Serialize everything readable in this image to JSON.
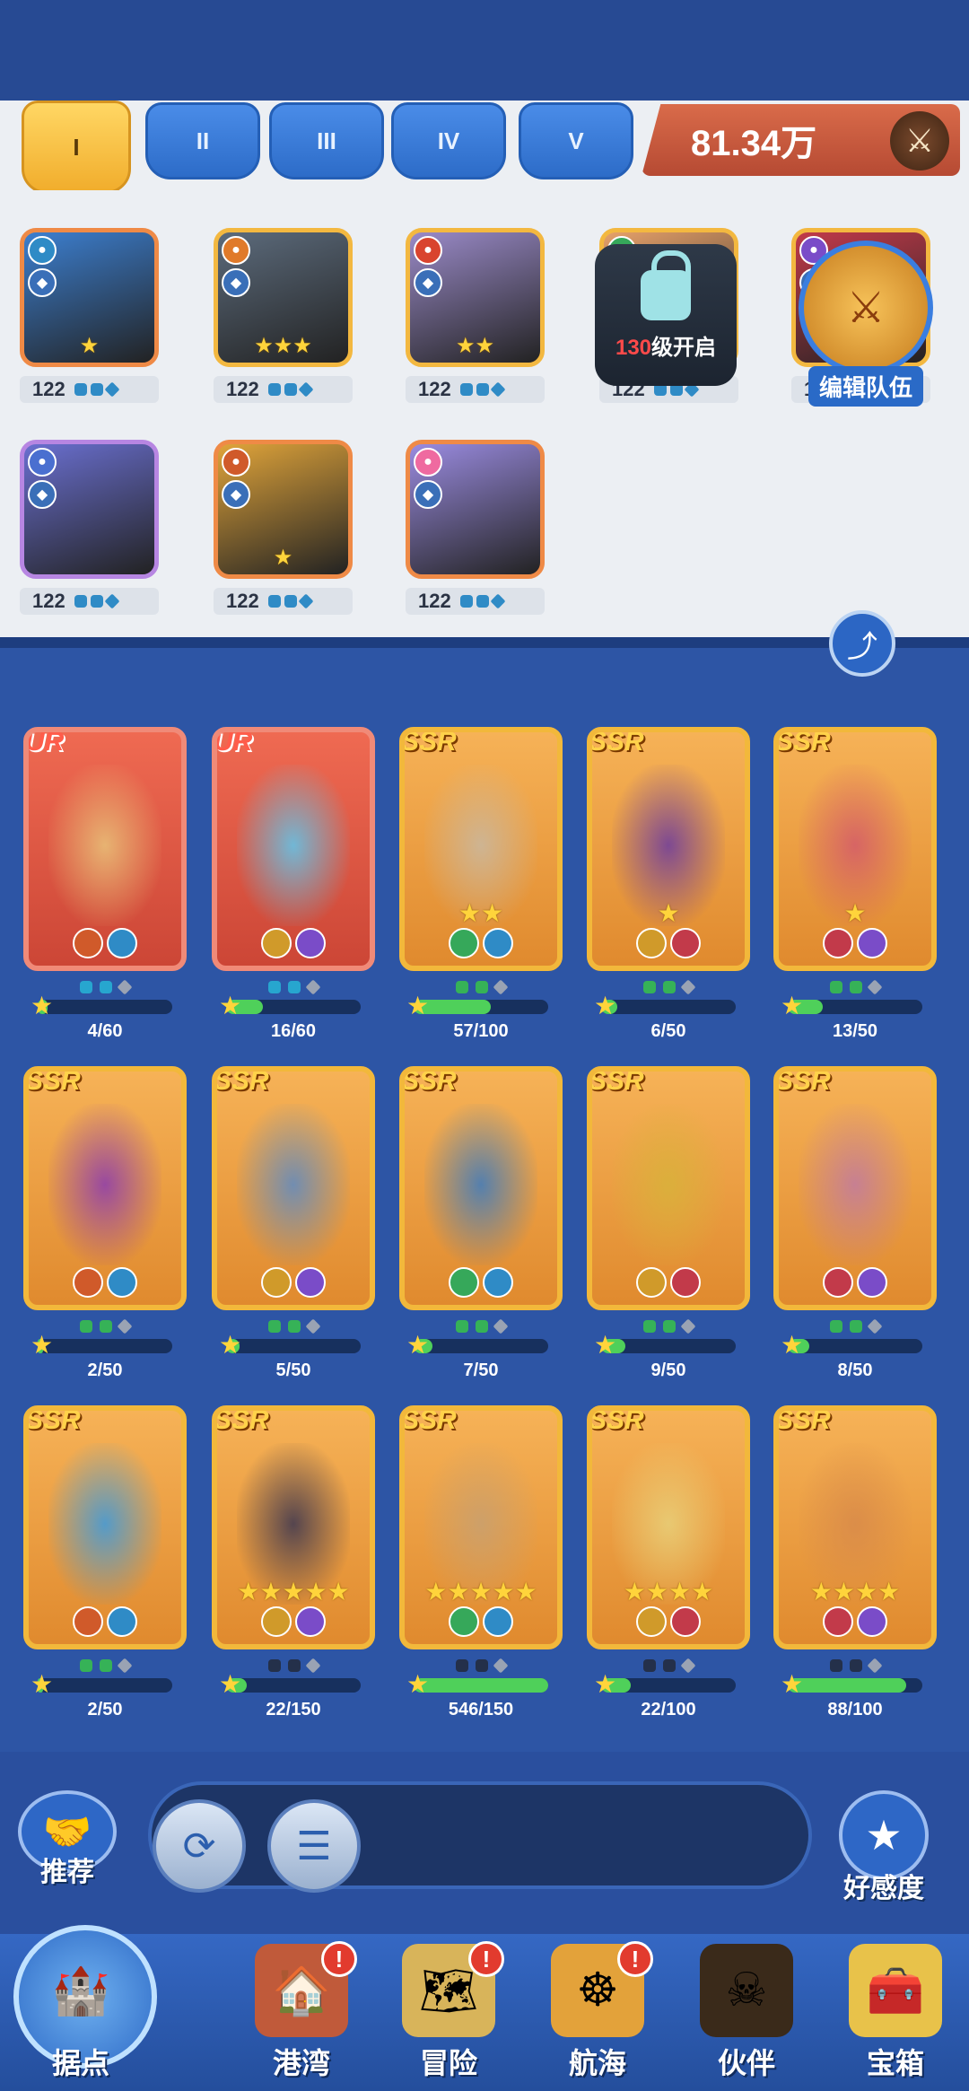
{
  "formation": {
    "tabs": [
      {
        "label": "I",
        "active": true
      },
      {
        "label": "II",
        "active": false
      },
      {
        "label": "III",
        "active": false
      },
      {
        "label": "IV",
        "active": false
      },
      {
        "label": "V",
        "active": false
      }
    ],
    "power": "81.34万"
  },
  "team": [
    {
      "level": "122",
      "stars": "★",
      "border": "orange",
      "color": "#3c7fd0"
    },
    {
      "level": "122",
      "stars": "★★★",
      "border": "gold",
      "color": "#5c6b7c"
    },
    {
      "level": "122",
      "stars": "★★",
      "border": "gold",
      "color": "#9a8ac8"
    },
    {
      "level": "122",
      "stars": "★★",
      "border": "gold",
      "color": "#e6a16a"
    },
    {
      "level": "122",
      "stars": "★★",
      "border": "gold",
      "color": "#c23a4a"
    },
    {
      "level": "122",
      "stars": "",
      "border": "purple",
      "color": "#6a6fd0"
    },
    {
      "level": "122",
      "stars": "★",
      "border": "orange",
      "color": "#e0a43a"
    },
    {
      "level": "122",
      "stars": "",
      "border": "orange",
      "color": "#9a8be0"
    }
  ],
  "locked_slot": {
    "level_num": "130",
    "suffix": "级开启"
  },
  "edit_team": "编辑队伍",
  "roster": [
    {
      "rarity": "UR",
      "count": "4/60",
      "stars": "",
      "progress": 0.07,
      "color": "#e9c37a"
    },
    {
      "rarity": "UR",
      "count": "16/60",
      "stars": "",
      "progress": 0.27,
      "color": "#5ec8ef"
    },
    {
      "rarity": "SSR",
      "count": "57/100",
      "stars": "★★",
      "progress": 0.57,
      "color": "#c9b8a0"
    },
    {
      "rarity": "SSR",
      "count": "6/50",
      "stars": "★",
      "progress": 0.12,
      "color": "#6a3aa0"
    },
    {
      "rarity": "SSR",
      "count": "13/50",
      "stars": "★",
      "progress": 0.26,
      "color": "#d35a6a"
    },
    {
      "rarity": "SSR",
      "count": "2/50",
      "stars": "",
      "progress": 0.04,
      "color": "#8a3ab0"
    },
    {
      "rarity": "SSR",
      "count": "5/50",
      "stars": "",
      "progress": 0.1,
      "color": "#5c8ac4"
    },
    {
      "rarity": "SSR",
      "count": "7/50",
      "stars": "",
      "progress": 0.14,
      "color": "#3a7ac0"
    },
    {
      "rarity": "SSR",
      "count": "9/50",
      "stars": "",
      "progress": 0.18,
      "color": "#d8b23a"
    },
    {
      "rarity": "SSR",
      "count": "8/50",
      "stars": "",
      "progress": 0.16,
      "color": "#c07aa0"
    },
    {
      "rarity": "SSR",
      "count": "2/50",
      "stars": "",
      "progress": 0.04,
      "color": "#3a9ae0"
    },
    {
      "rarity": "SSR",
      "count": "22/150",
      "stars": "★★★★★",
      "progress": 0.15,
      "color": "#3a3550"
    },
    {
      "rarity": "SSR",
      "count": "546/150",
      "stars": "★★★★★",
      "progress": 1.0,
      "color": "#c8a070"
    },
    {
      "rarity": "SSR",
      "count": "22/100",
      "stars": "★★★★",
      "progress": 0.22,
      "color": "#e8d07a"
    },
    {
      "rarity": "SSR",
      "count": "88/100",
      "stars": "★★★★",
      "progress": 0.88,
      "color": "#d88a4a"
    }
  ],
  "actions": {
    "recommend": "推荐",
    "favor": "好感度"
  },
  "nav": [
    {
      "label": "据点",
      "badge": "",
      "icon": "🏰"
    },
    {
      "label": "港湾",
      "badge": "!",
      "icon": "🏠"
    },
    {
      "label": "冒险",
      "badge": "!",
      "icon": "🗺"
    },
    {
      "label": "航海",
      "badge": "!",
      "icon": "☸"
    },
    {
      "label": "伙伴",
      "badge": "",
      "icon": "☠"
    },
    {
      "label": "宝箱",
      "badge": "",
      "icon": "🧰"
    }
  ],
  "colors": {
    "accent": "#2d55a5",
    "gold": "#f2b83b",
    "ur": "#f08a78",
    "progress": "#4fd05a"
  }
}
